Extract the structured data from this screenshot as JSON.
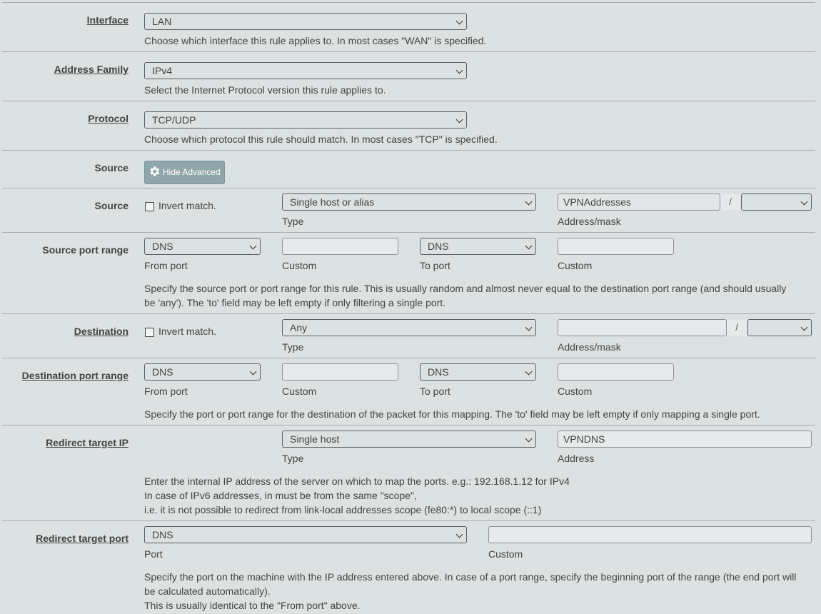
{
  "interface": {
    "label": "Interface",
    "value": "LAN",
    "help": "Choose which interface this rule applies to. In most cases \"WAN\" is specified."
  },
  "address_family": {
    "label": "Address Family",
    "value": "IPv4",
    "help": "Select the Internet Protocol version this rule applies to."
  },
  "protocol": {
    "label": "Protocol",
    "value": "TCP/UDP",
    "help": "Choose which protocol this rule should match. In most cases \"TCP\" is specified."
  },
  "source_advanced": {
    "label": "Source",
    "button_label": "Hide Advanced"
  },
  "source": {
    "label": "Source",
    "invert_label": "Invert match.",
    "type_value": "Single host or alias",
    "type_hint": "Type",
    "address_value": "VPNAddresses",
    "slash": "/",
    "mask_value": "",
    "address_hint": "Address/mask"
  },
  "source_port_range": {
    "label": "Source port range",
    "from_value": "DNS",
    "from_hint": "From port",
    "custom_from_hint": "Custom",
    "to_value": "DNS",
    "to_hint": "To port",
    "custom_to_hint": "Custom",
    "help_line1": "Specify the source port or port range for this rule. This is usually random and almost never equal to the destination port range (and should usually",
    "help_line2": "be 'any'). The 'to' field may be left empty if only filtering a single port."
  },
  "destination": {
    "label": "Destination",
    "invert_label": "Invert match.",
    "type_value": "Any",
    "type_hint": "Type",
    "address_value": "",
    "slash": "/",
    "mask_value": "",
    "address_hint": "Address/mask"
  },
  "destination_port_range": {
    "label": "Destination port range",
    "from_value": "DNS",
    "from_hint": "From port",
    "custom_from_hint": "Custom",
    "to_value": "DNS",
    "to_hint": "To port",
    "custom_to_hint": "Custom",
    "help": "Specify the port or port range for the destination of the packet for this mapping. The 'to' field may be left empty if only mapping a single port."
  },
  "redirect_target_ip": {
    "label": "Redirect target IP",
    "type_value": "Single host",
    "type_hint": "Type",
    "address_value": "VPNDNS",
    "address_hint": "Address",
    "help_line1": "Enter the internal IP address of the server on which to map the ports. e.g.: 192.168.1.12 for IPv4",
    "help_line2": "In case of IPv6 addresses, in must be from the same \"scope\",",
    "help_line3": "i.e. it is not possible to redirect from link-local addresses scope (fe80:*) to local scope (::1)"
  },
  "redirect_target_port": {
    "label": "Redirect target port",
    "port_value": "DNS",
    "port_hint": "Port",
    "custom_value": "",
    "custom_hint": "Custom",
    "help_line1": "Specify the port on the machine with the IP address entered above. In case of a port range, specify the beginning port of the range (the end port will",
    "help_line2": "be calculated automatically).",
    "help_line3": "This is usually identical to the \"From port\" above."
  }
}
